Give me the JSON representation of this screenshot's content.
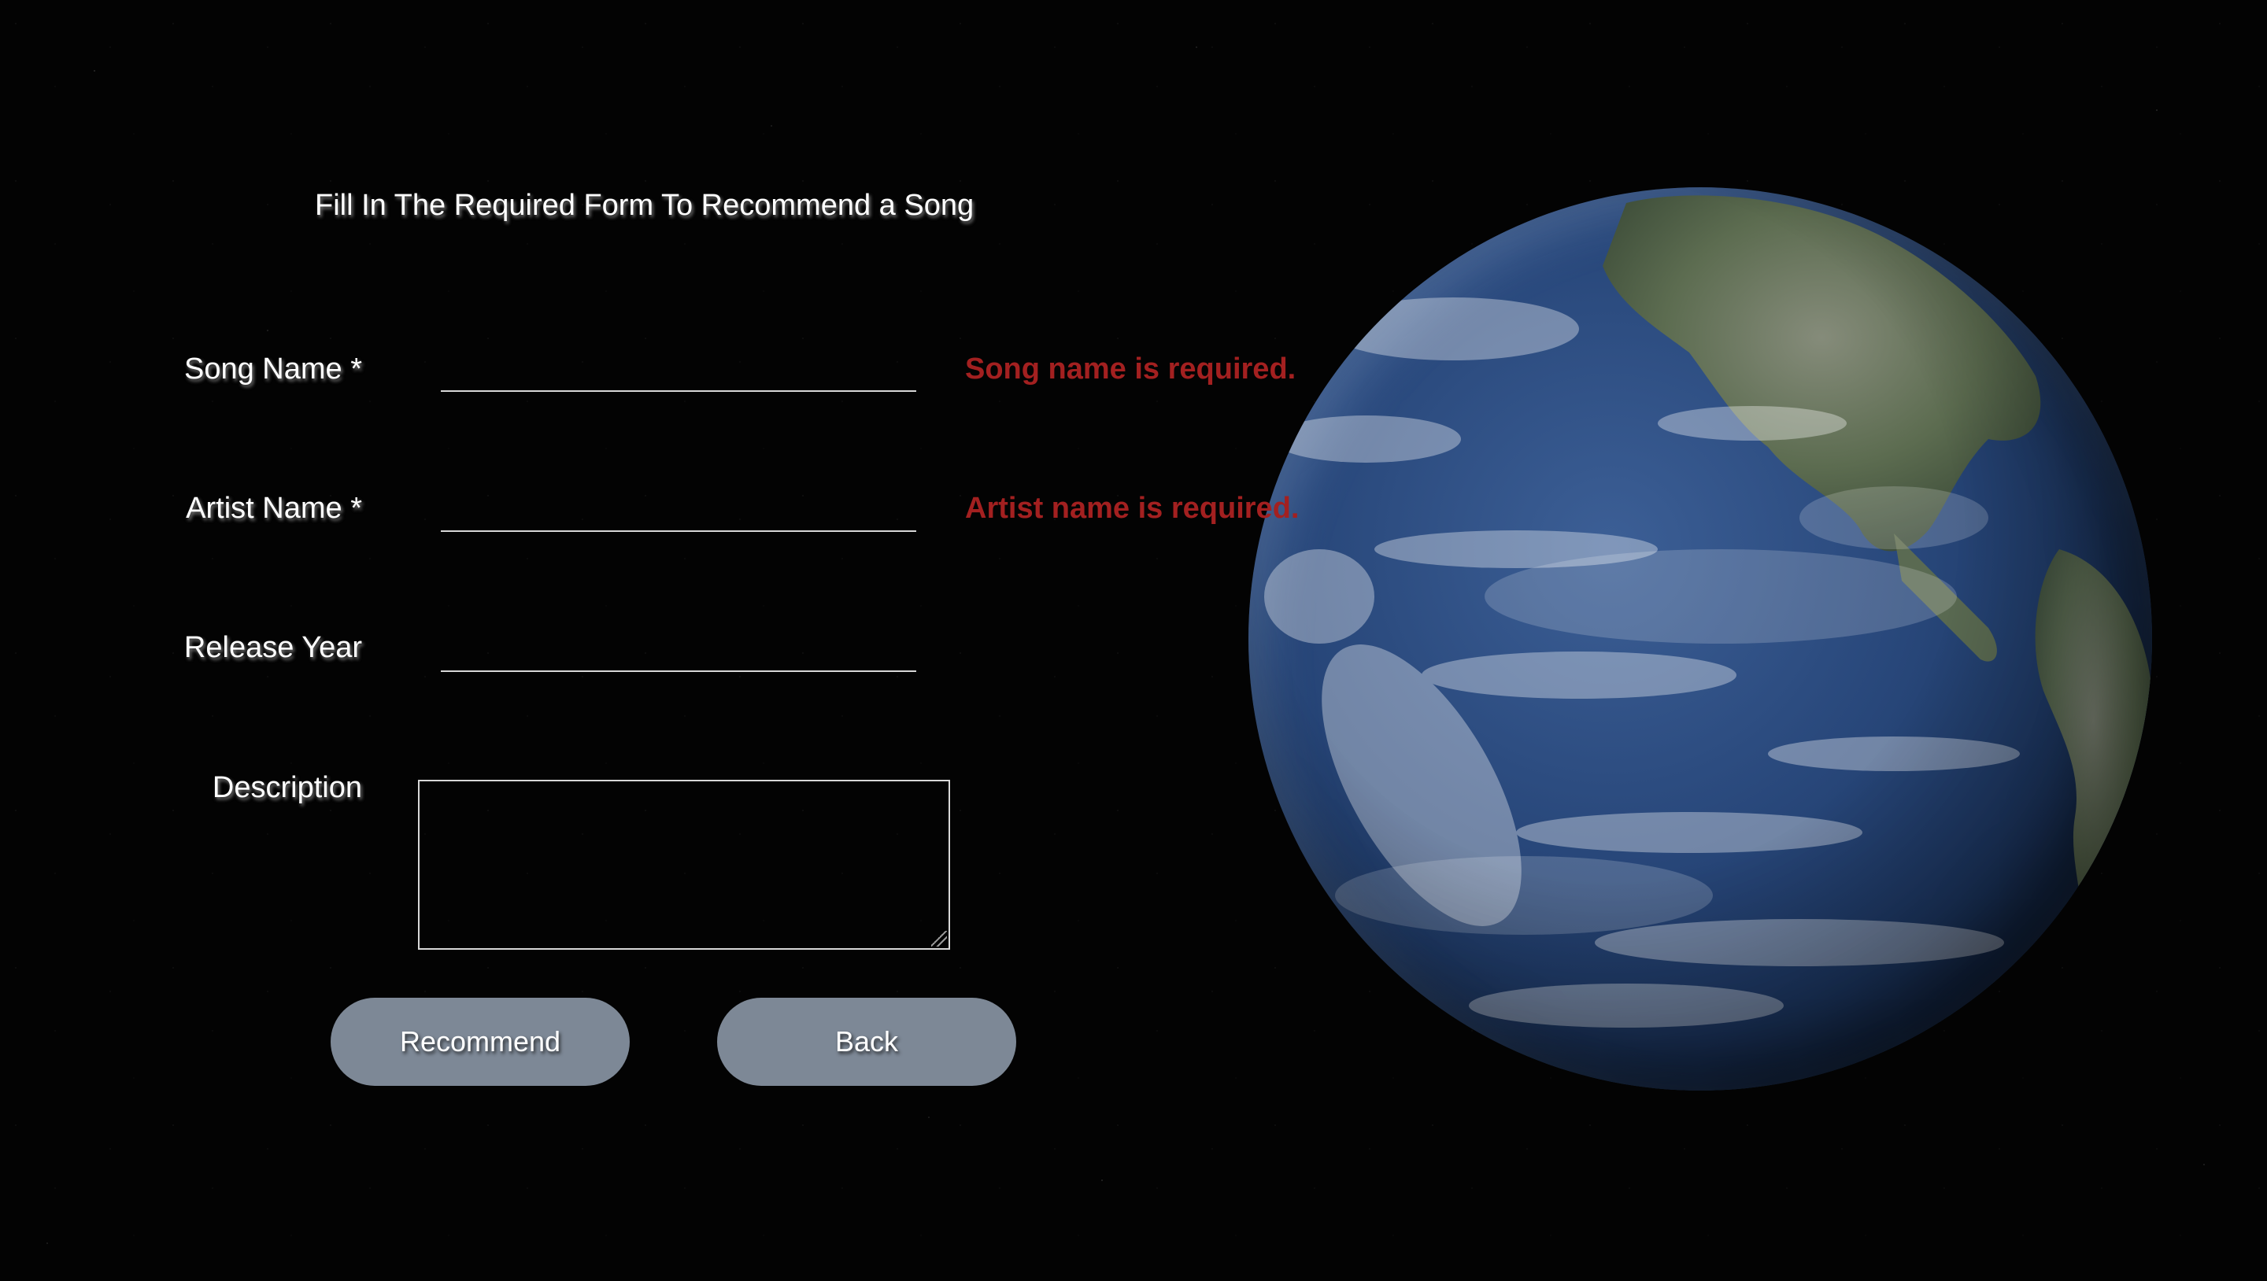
{
  "page": {
    "title": "Fill In The Required Form To Recommend a Song"
  },
  "form": {
    "song_name": {
      "label": "Song Name *",
      "value": "",
      "error": "Song name is required."
    },
    "artist_name": {
      "label": "Artist Name *",
      "value": "",
      "error": "Artist name is required."
    },
    "release_year": {
      "label": "Release Year",
      "value": ""
    },
    "description": {
      "label": "Description",
      "value": ""
    }
  },
  "buttons": {
    "recommend": "Recommend",
    "back": "Back"
  },
  "colors": {
    "background": "#030303",
    "text": "#ffffff",
    "error": "#a32020",
    "button": "#7d8896",
    "input_border": "#d8d8d8"
  },
  "decor": {
    "background_image": "earth-globe"
  }
}
